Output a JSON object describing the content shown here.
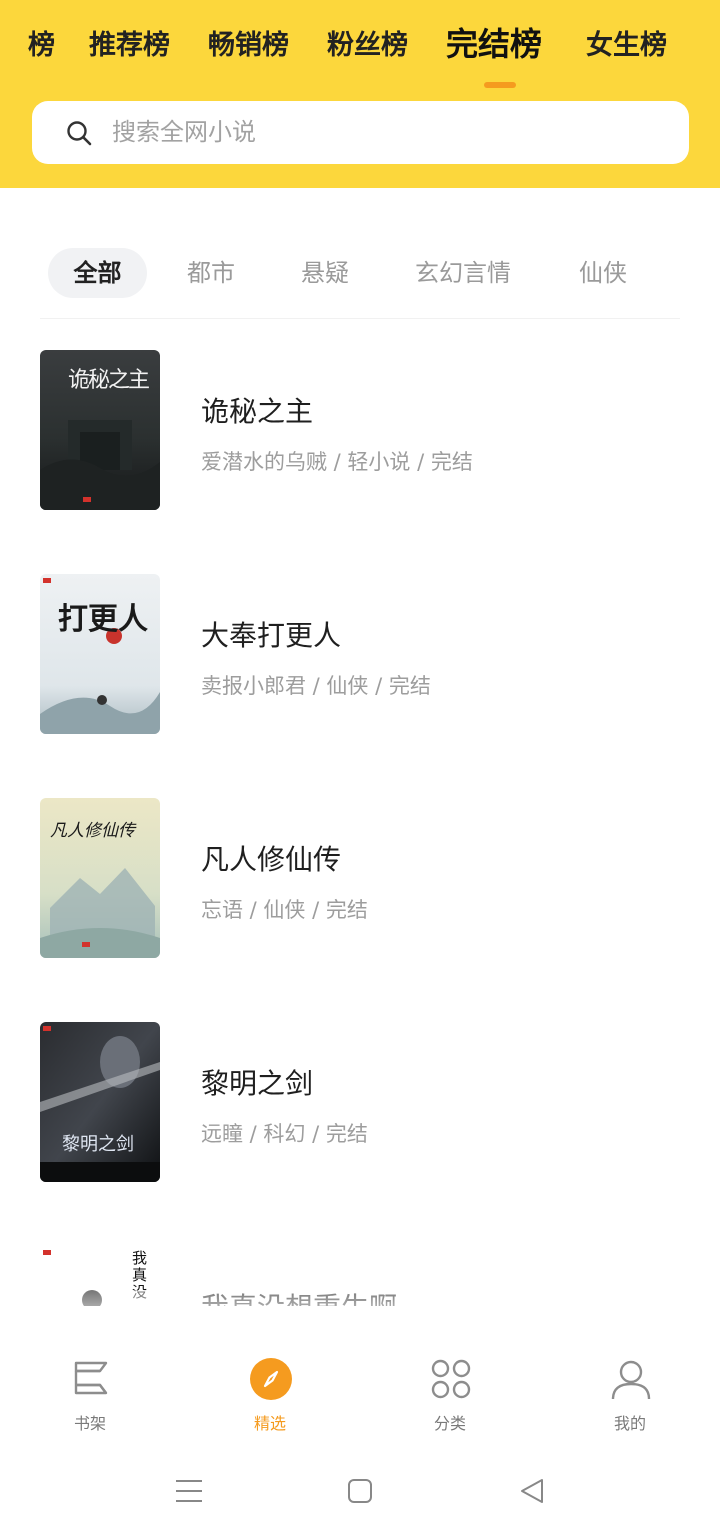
{
  "tabs": {
    "items": [
      "榜",
      "推荐榜",
      "畅销榜",
      "粉丝榜",
      "完结榜",
      "女生榜"
    ],
    "active_index": 4
  },
  "search": {
    "placeholder": "搜索全网小说",
    "icon": "search-icon"
  },
  "categories": {
    "items": [
      "全部",
      "都市",
      "悬疑",
      "玄幻言情",
      "仙侠"
    ],
    "active_index": 0
  },
  "books": [
    {
      "title": "诡秘之主",
      "meta": "爱潜水的乌贼 / 轻小说 / 完结",
      "cover_text": "诡秘之主"
    },
    {
      "title": "大奉打更人",
      "meta": "卖报小郎君 / 仙侠 / 完结",
      "cover_text": "打更人"
    },
    {
      "title": "凡人修仙传",
      "meta": "忘语 / 仙侠 / 完结",
      "cover_text": "凡人修仙传"
    },
    {
      "title": "黎明之剑",
      "meta": "远瞳 / 科幻 / 完结",
      "cover_text": "黎明之剑"
    },
    {
      "title": "我真没想重生啊",
      "meta": "",
      "cover_text": "我真没"
    }
  ],
  "bottom_nav": {
    "items": [
      {
        "label": "书架",
        "icon": "bookshelf-icon"
      },
      {
        "label": "精选",
        "icon": "compass-icon"
      },
      {
        "label": "分类",
        "icon": "category-icon"
      },
      {
        "label": "我的",
        "icon": "profile-icon"
      }
    ],
    "active_index": 1
  },
  "colors": {
    "header_bg": "#fcd73c",
    "accent": "#f59b1f",
    "muted_text": "#9d9d9d"
  }
}
